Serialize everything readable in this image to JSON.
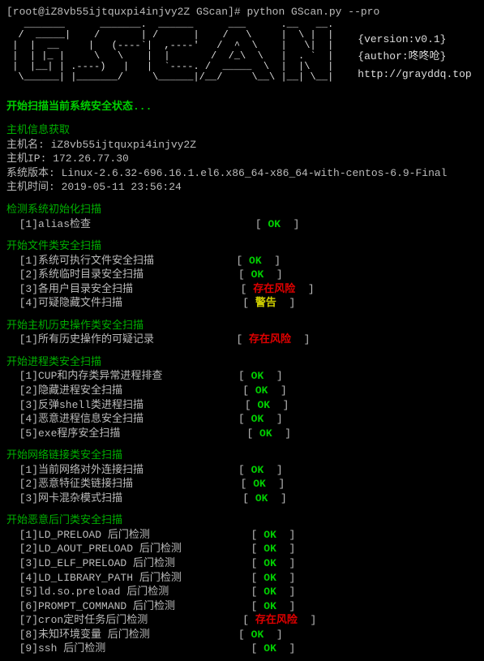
{
  "prompt": "[root@iZ8vb55ijtquxpi4injvy2Z GScan]# python GScan.py --pro",
  "ascii": "   _______      _______.  ______      ___      .__   __.\n  /  _____|    /       | /      |    /   \\     |  \\ |  |\n |  |  __     |   (----`|  ,----'   /  ^  \\    |   \\|  |\n |  | |_ |     \\   \\    |  |       /  /_\\  \\   |  . `  |\n |  |__| | .----)   |   |  `----. /  _____  \\  |  |\\   |\n  \\______| |_______/     \\______|/__/     \\__\\ |__| \\__|",
  "meta": {
    "version": "{version:v0.1}",
    "author": "{author:咚咚呛}",
    "url": "http://grayddq.top"
  },
  "start_scan": "开始扫描当前系统安全状态...",
  "host": {
    "header": "主机信息获取",
    "hostname_label": "主机名: iZ8vb55ijtquxpi4injvy2Z",
    "ip_label": "主机IP: 172.26.77.30",
    "sysver_label": "系统版本: Linux-2.6.32-696.16.1.el6.x86_64-x86_64-with-centos-6.9-Final",
    "time_label": "主机时间: 2019-05-11 23:56:24"
  },
  "sections": [
    {
      "title": "检测系统初始化扫描",
      "items": [
        {
          "label": "[1]alias检查",
          "status": "OK",
          "type": "ok"
        }
      ]
    },
    {
      "title": "开始文件类安全扫描",
      "items": [
        {
          "label": "[1]系统可执行文件安全扫描",
          "status": "OK",
          "type": "ok"
        },
        {
          "label": "[2]系统临时目录安全扫描",
          "status": "OK",
          "type": "ok"
        },
        {
          "label": "[3]各用户目录安全扫描",
          "status": "存在风险",
          "type": "risk"
        },
        {
          "label": "[4]可疑隐藏文件扫描",
          "status": "警告",
          "type": "warn"
        }
      ]
    },
    {
      "title": "开始主机历史操作类安全扫描",
      "items": [
        {
          "label": "[1]所有历史操作的可疑记录",
          "status": "存在风险",
          "type": "risk"
        }
      ]
    },
    {
      "title": "开始进程类安全扫描",
      "items": [
        {
          "label": "[1]CUP和内存类异常进程排查",
          "status": "OK",
          "type": "ok"
        },
        {
          "label": "[2]隐藏进程安全扫描",
          "status": "OK",
          "type": "ok"
        },
        {
          "label": "[3]反弹shell类进程扫描",
          "status": "OK",
          "type": "ok"
        },
        {
          "label": "[4]恶意进程信息安全扫描",
          "status": "OK",
          "type": "ok"
        },
        {
          "label": "[5]exe程序安全扫描",
          "status": "OK",
          "type": "ok"
        }
      ]
    },
    {
      "title": "开始网络链接类安全扫描",
      "items": [
        {
          "label": "[1]当前网络对外连接扫描",
          "status": "OK",
          "type": "ok"
        },
        {
          "label": "[2]恶意特征类链接扫描",
          "status": "OK",
          "type": "ok"
        },
        {
          "label": "[3]网卡混杂模式扫描",
          "status": "OK",
          "type": "ok"
        }
      ]
    },
    {
      "title": "开始恶意后门类安全扫描",
      "items": [
        {
          "label": "[1]LD_PRELOAD 后门检测",
          "status": "OK",
          "type": "ok"
        },
        {
          "label": "[2]LD_AOUT_PRELOAD 后门检测",
          "status": "OK",
          "type": "ok"
        },
        {
          "label": "[3]LD_ELF_PRELOAD 后门检测",
          "status": "OK",
          "type": "ok"
        },
        {
          "label": "[4]LD_LIBRARY_PATH 后门检测",
          "status": "OK",
          "type": "ok"
        },
        {
          "label": "[5]ld.so.preload 后门检测",
          "status": "OK",
          "type": "ok"
        },
        {
          "label": "[6]PROMPT_COMMAND 后门检测",
          "status": "OK",
          "type": "ok"
        },
        {
          "label": "[7]cron定时任务后门检测",
          "status": "存在风险",
          "type": "risk"
        },
        {
          "label": "[8]未知环境变量 后门检测",
          "status": "OK",
          "type": "ok"
        },
        {
          "label": "[9]ssh 后门检测",
          "status": "OK",
          "type": "ok"
        }
      ]
    }
  ]
}
